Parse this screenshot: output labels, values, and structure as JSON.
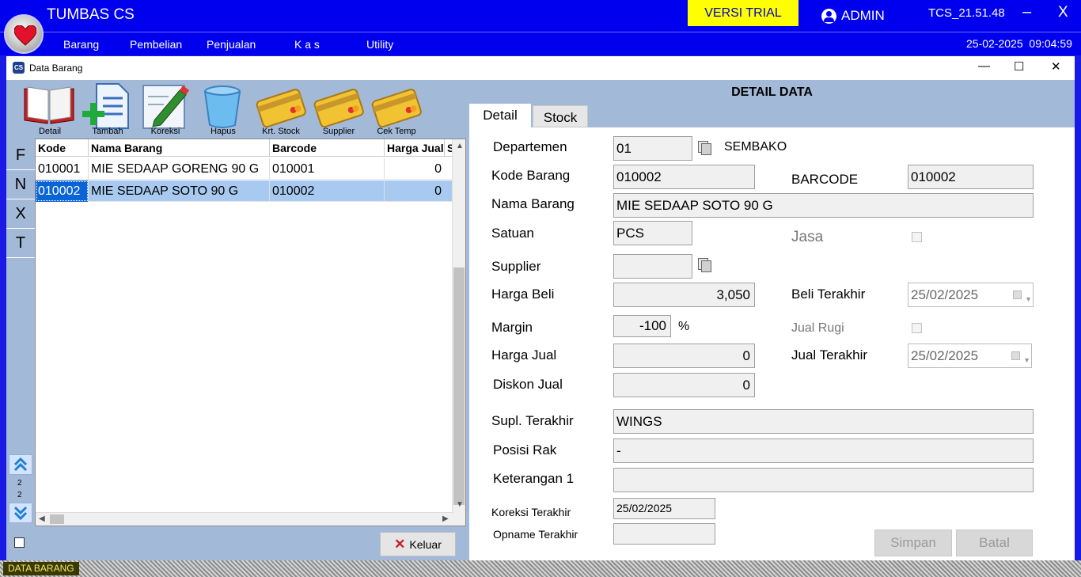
{
  "app": {
    "title": "TUMBAS CS",
    "trial_label": "VERSI TRIAL",
    "user": "ADMIN",
    "version": "TCS_21.51.48",
    "minimize_glyph": "–",
    "close_glyph": "X",
    "date": "25-02-2025",
    "time": "09:04:59"
  },
  "menu": [
    "Barang",
    "Pembelian",
    "Penjualan",
    "K a s",
    "Utility"
  ],
  "window": {
    "title": "Data Barang",
    "icon_text": "CS",
    "minimize_glyph": "—",
    "maximize_glyph": "☐",
    "close_glyph": "✕"
  },
  "toolbar": [
    {
      "label": "Detail",
      "icon": "book-icon"
    },
    {
      "label": "Tambah",
      "icon": "add-document-icon"
    },
    {
      "label": "Koreksi",
      "icon": "edit-pencil-icon"
    },
    {
      "label": "Hapus",
      "icon": "trash-icon"
    },
    {
      "label": "Krt. Stock",
      "icon": "card-icon"
    },
    {
      "label": "Supplier",
      "icon": "card-icon"
    },
    {
      "label": "Cek Temp",
      "icon": "card-icon"
    }
  ],
  "side_buttons": [
    "F",
    "N",
    "X",
    "T"
  ],
  "pager": {
    "current": "2",
    "total": "2"
  },
  "grid": {
    "columns": [
      "Kode",
      "Nama Barang",
      "Barcode",
      "Harga Jual",
      "S"
    ],
    "rows": [
      {
        "kode": "010001",
        "nama": "MIE SEDAAP GORENG 90 G",
        "barcode": "010001",
        "harga": "0"
      },
      {
        "kode": "010002",
        "nama": "MIE SEDAAP SOTO 90 G",
        "barcode": "010002",
        "harga": "0"
      }
    ],
    "selected_index": 1
  },
  "keluar_label": "Keluar",
  "detail": {
    "header": "DETAIL DATA",
    "tabs": [
      "Detail",
      "Stock"
    ],
    "labels": {
      "departemen": "Departemen",
      "kode_barang": "Kode Barang",
      "barcode": "BARCODE",
      "nama_barang": "Nama Barang",
      "satuan": "Satuan",
      "jasa": "Jasa",
      "supplier": "Supplier",
      "harga_beli": "Harga Beli",
      "beli_terakhir": "Beli Terakhir",
      "margin": "Margin",
      "percent": "%",
      "jual_rugi": "Jual Rugi",
      "harga_jual": "Harga Jual",
      "jual_terakhir": "Jual Terakhir",
      "diskon_jual": "Diskon Jual",
      "supl_terakhir": "Supl. Terakhir",
      "posisi_rak": "Posisi Rak",
      "keterangan1": "Keterangan 1",
      "koreksi_terakhir": "Koreksi Terakhir",
      "opname_terakhir": "Opname Terakhir"
    },
    "values": {
      "departemen_code": "01",
      "departemen_name": "SEMBAKO",
      "kode_barang": "010002",
      "barcode": "010002",
      "nama_barang": "MIE SEDAAP SOTO 90 G",
      "satuan": "PCS",
      "jasa_checked": false,
      "supplier": "",
      "harga_beli": "3,050",
      "beli_terakhir": "25/02/2025",
      "margin": "-100",
      "jual_rugi_checked": false,
      "harga_jual": "0",
      "jual_terakhir": "25/02/2025",
      "diskon_jual": "0",
      "supl_terakhir": "WINGS",
      "posisi_rak": "-",
      "keterangan1": "",
      "koreksi_terakhir": "25/02/2025",
      "opname_terakhir": ""
    },
    "buttons": {
      "simpan": "Simpan",
      "batal": "Batal"
    }
  },
  "status_label": "DATA BARANG",
  "colors": {
    "app_bar": "#0000ee",
    "trial_bg": "#ffff00",
    "panel_bg": "#a3b9d8",
    "selection": "#a9caf0",
    "focus": "#0a64d6"
  }
}
